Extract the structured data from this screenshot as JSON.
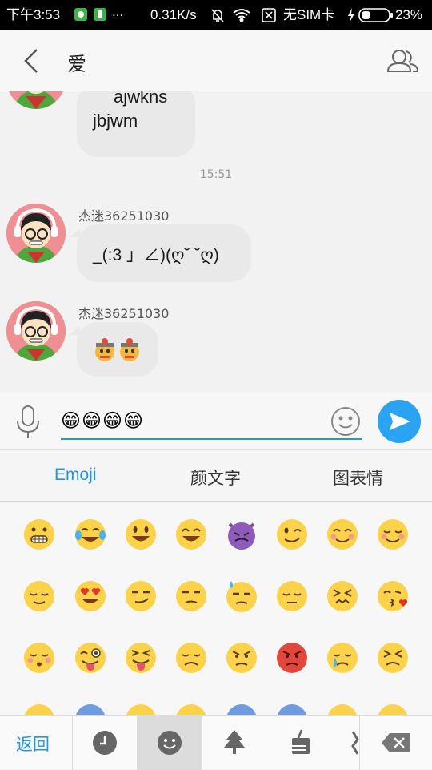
{
  "status_bar": {
    "time": "下午3:53",
    "more": "...",
    "speed": "0.31K/s",
    "sim": "无SIM卡",
    "battery": "23%"
  },
  "header": {
    "title": "爱"
  },
  "chat": {
    "messages": [
      {
        "line1": "ajwkns",
        "line2": "jbjwm"
      },
      {
        "time": "15:51"
      },
      {
        "sender": "杰迷36251030",
        "text": "_(:3 」∠)(ღ˘ ˘ღ)"
      },
      {
        "sender": "杰迷36251030",
        "text": "🤯🤯"
      }
    ]
  },
  "input": {
    "value": "😁😁😁😁"
  },
  "keyboard": {
    "tabs": [
      "Emoji",
      "颜文字",
      "图表情"
    ],
    "active_tab": "Emoji"
  },
  "bottom_bar": {
    "back_label": "返回"
  },
  "colors": {
    "accent": "#2196e6",
    "send": "#2aa4f2",
    "bubble": "#e9e9e9",
    "emoji_yellow": "#fbd24a"
  }
}
